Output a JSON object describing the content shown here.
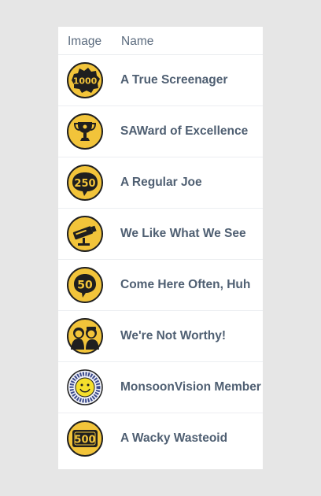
{
  "table": {
    "headers": {
      "image": "Image",
      "name": "Name"
    },
    "rows": [
      {
        "name": "A True Screenager",
        "icon": "badge-1000-icon"
      },
      {
        "name": "SAWard of Excellence",
        "icon": "badge-trophy-icon"
      },
      {
        "name": "A Regular Joe",
        "icon": "badge-250-icon"
      },
      {
        "name": "We Like What We See",
        "icon": "badge-camera-icon"
      },
      {
        "name": "Come Here Often, Huh",
        "icon": "badge-50-icon"
      },
      {
        "name": "We're Not Worthy!",
        "icon": "badge-faces-icon"
      },
      {
        "name": "MonsoonVision Member",
        "icon": "badge-smiley-icon"
      },
      {
        "name": "A Wacky Wasteoid",
        "icon": "badge-500-icon"
      }
    ]
  },
  "colors": {
    "badge_yellow": "#f2c43a",
    "badge_dark": "#1f1f1f",
    "row_text": "#4f5f72",
    "header_text": "#5b6b7e"
  }
}
